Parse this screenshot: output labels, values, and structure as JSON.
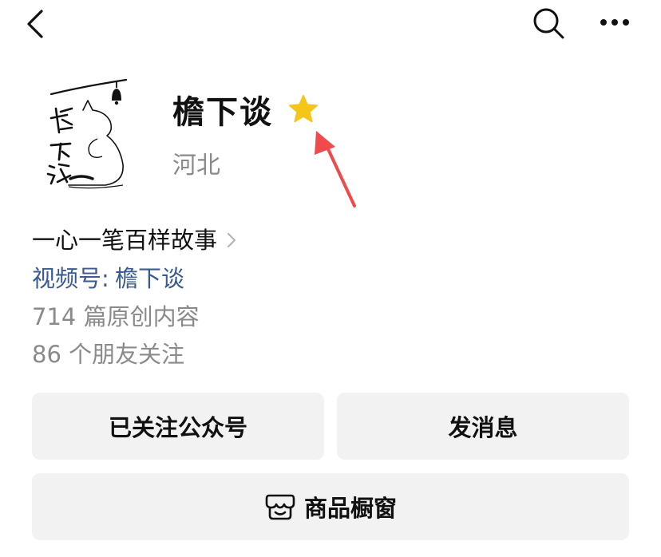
{
  "topbar": {
    "back_icon": "chevron-left-icon",
    "search_icon": "search-icon",
    "more_icon": "more-dots-icon"
  },
  "profile": {
    "avatar_alt": "檐下谈",
    "name": "檐下谈",
    "star_icon": "star-icon",
    "star_color": "#F5C518",
    "annotation_arrow_color": "#F04A4A",
    "region": "河北",
    "bio": "一心一笔百样故事",
    "channel_label": "视频号:",
    "channel_name": "檐下谈",
    "channel_color": "#3A5A92",
    "articles": "714 篇原创内容",
    "friends": "86 个朋友关注"
  },
  "actions": {
    "followed_label": "已关注公众号",
    "message_label": "发消息",
    "shop_label": "商品橱窗",
    "shop_icon": "storefront-icon"
  }
}
